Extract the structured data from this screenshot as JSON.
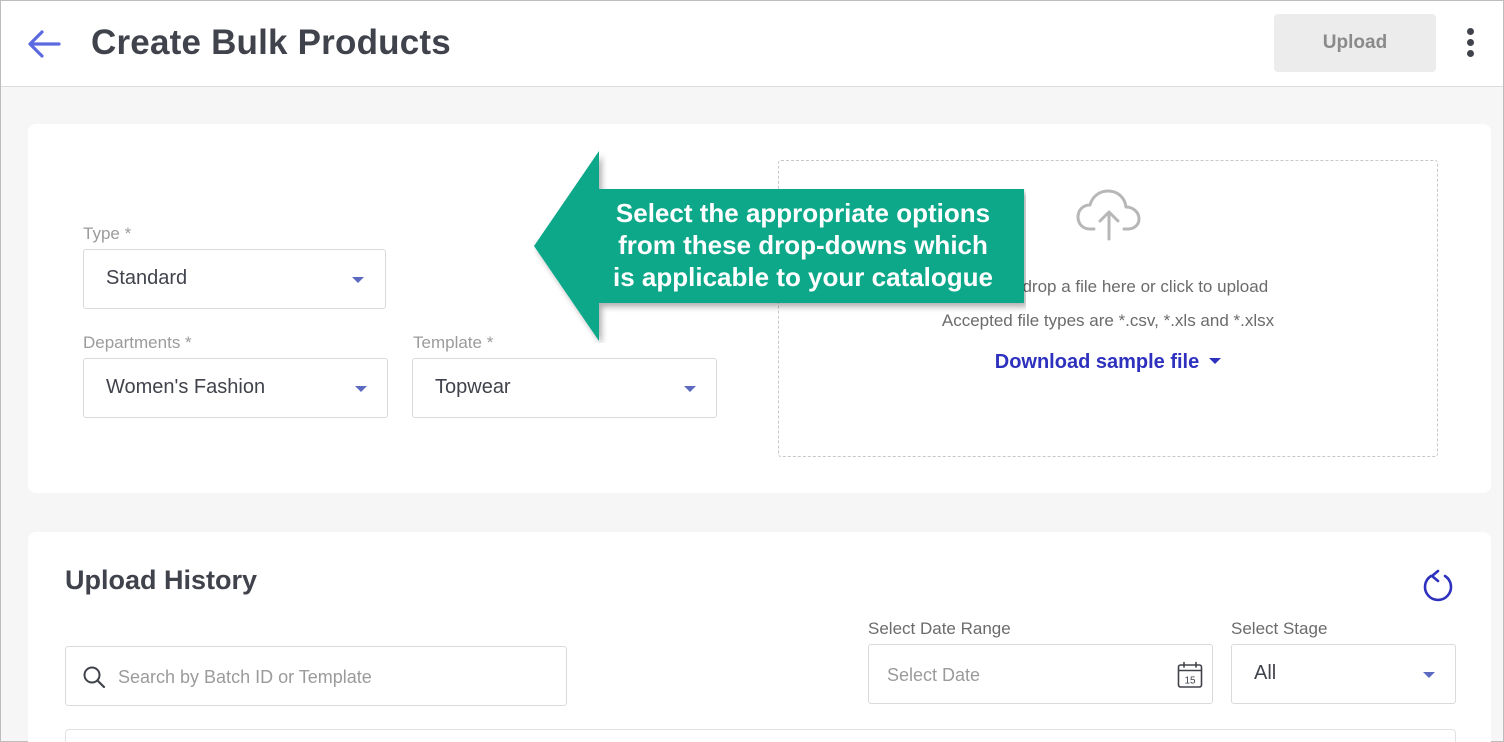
{
  "header": {
    "title": "Create Bulk Products",
    "upload_label": "Upload"
  },
  "form": {
    "type": {
      "label": "Type *",
      "value": "Standard"
    },
    "departments": {
      "label": "Departments *",
      "value": "Women's Fashion"
    },
    "template": {
      "label": "Template *",
      "value": "Topwear"
    }
  },
  "dropzone": {
    "main_text": "Drag and drop a file here or click to upload",
    "types_text": "Accepted file types are *.csv, *.xls and *.xlsx",
    "download_label": "Download sample file"
  },
  "callout": {
    "line1": "Select the appropriate options",
    "line2": "from these drop-downs which",
    "line3": "is applicable to your catalogue",
    "color": "#0aa88a"
  },
  "history": {
    "title": "Upload History",
    "search_placeholder": "Search by Batch ID or Template",
    "date_label": "Select Date Range",
    "date_placeholder": "Select Date",
    "calendar_day": "15",
    "stage_label": "Select Stage",
    "stage_value": "All"
  },
  "colors": {
    "accent": "#2e31be",
    "caret": "#5c6bc0",
    "title_text": "#41434c"
  },
  "icons": {
    "back": "arrow-left-icon",
    "more": "kebab-menu-icon",
    "upload": "cloud-upload-icon",
    "refresh": "refresh-icon",
    "search": "search-icon",
    "calendar": "calendar-icon"
  }
}
